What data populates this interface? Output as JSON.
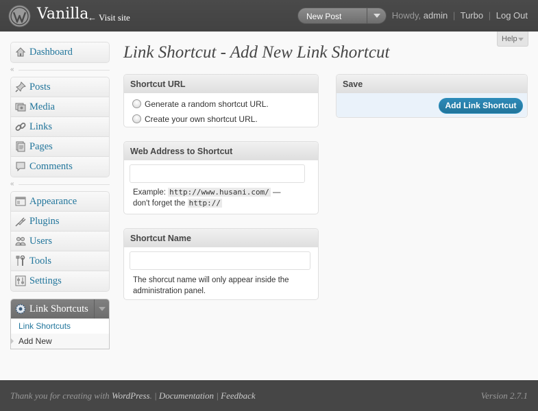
{
  "header": {
    "site_title": "Vanilla",
    "visit_site": "← Visit site",
    "favorite_action": "New Post",
    "howdy": "Howdy,",
    "user": "admin",
    "turbo": "Turbo",
    "logout": "Log Out",
    "separator": "|"
  },
  "help": {
    "label": "Help"
  },
  "sidebar": {
    "dashboard": "Dashboard",
    "posts": "Posts",
    "media": "Media",
    "links": "Links",
    "pages": "Pages",
    "comments": "Comments",
    "appearance": "Appearance",
    "plugins": "Plugins",
    "users": "Users",
    "tools": "Tools",
    "settings": "Settings",
    "current_menu": "Link Shortcuts",
    "submenu": [
      "Link Shortcuts",
      "Add New"
    ],
    "collapse_glyph": "«"
  },
  "main": {
    "page_title": "Link Shortcut - Add New Link Shortcut",
    "shortcut_url": {
      "title": "Shortcut URL",
      "option_random": "Generate a random shortcut URL.",
      "option_custom": "Create your own shortcut URL."
    },
    "web_address": {
      "title": "Web Address to Shortcut",
      "value": "",
      "hint_example": "Example:",
      "hint_example_code": "http://www.husani.com/",
      "hint_dash": "—",
      "hint_forget": "don't forget the",
      "hint_forget_code": "http://"
    },
    "shortcut_name": {
      "title": "Shortcut Name",
      "value": "",
      "hint": "The shorcut name will only appear inside the administration panel."
    },
    "save": {
      "title": "Save",
      "button": "Add Link Shortcut"
    }
  },
  "footer": {
    "thanks_prefix": "Thank you for creating with",
    "wordpress": "WordPress",
    "period": ".",
    "documentation": "Documentation",
    "feedback": "Feedback",
    "separator": "|",
    "version": "Version 2.7.1"
  },
  "colors": {
    "header_bg": "#464646",
    "link": "#21759b",
    "accent_button": "#21759b",
    "footer_bg": "#464646"
  },
  "icons": [
    "wordpress-logo-icon",
    "chevron-down-icon",
    "dashboard-icon",
    "posts-pin-icon",
    "media-icon",
    "links-chain-icon",
    "pages-icon",
    "comments-icon",
    "appearance-icon",
    "plugins-icon",
    "users-icon",
    "tools-icon",
    "settings-icon",
    "link-shortcuts-gear-icon",
    "collapse-chevron-icon"
  ]
}
